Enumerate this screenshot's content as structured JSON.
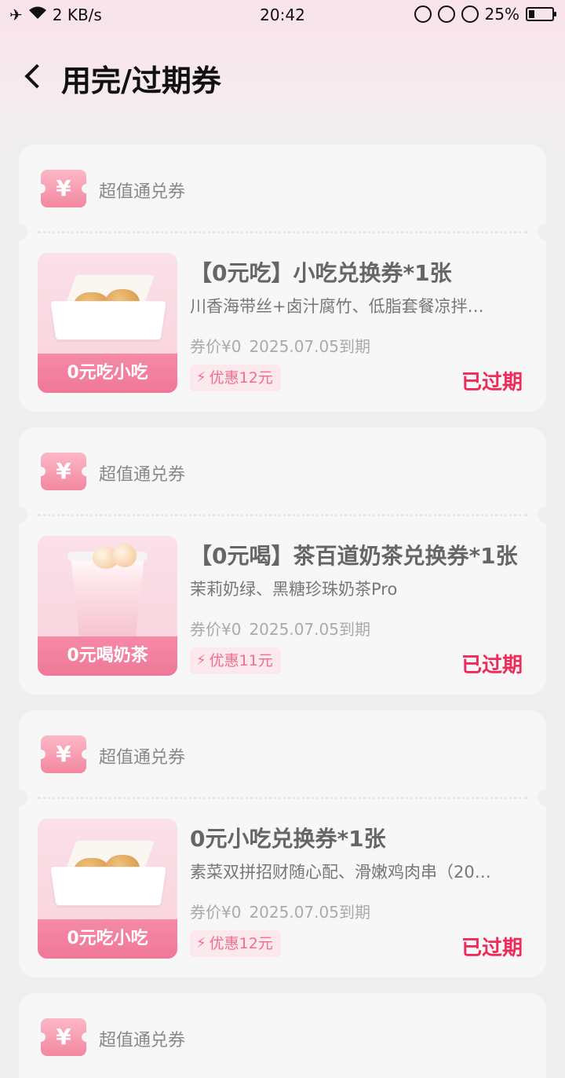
{
  "status_bar": {
    "speed": "2 KB/s",
    "time": "20:42",
    "battery_percent": "25%",
    "battery_level": 0.25
  },
  "header": {
    "title": "用完/过期券"
  },
  "cards": [
    {
      "type_label": "超值通兑券",
      "thumb_label": "0元吃小吃",
      "thumb_kind": "snack",
      "title": "【0元吃】小吃兑换券*1张",
      "desc": "川香海带丝+卤汁腐竹、低脂套餐凉拌…",
      "price": "券价¥0",
      "expiry": "2025.07.05到期",
      "discount": "优惠12元",
      "status": "已过期"
    },
    {
      "type_label": "超值通兑券",
      "thumb_label": "0元喝奶茶",
      "thumb_kind": "tea",
      "title": "【0元喝】茶百道奶茶兑换券*1张",
      "desc": "茉莉奶绿、黑糖珍珠奶茶Pro",
      "price": "券价¥0",
      "expiry": "2025.07.05到期",
      "discount": "优惠11元",
      "status": "已过期"
    },
    {
      "type_label": "超值通兑券",
      "thumb_label": "0元吃小吃",
      "thumb_kind": "snack",
      "title": "0元小吃兑换券*1张",
      "desc": "素菜双拼招财随心配、滑嫩鸡肉串（20…",
      "price": "券价¥0",
      "expiry": "2025.07.05到期",
      "discount": "优惠12元",
      "status": "已过期"
    },
    {
      "type_label": "超值通兑券"
    }
  ],
  "icons": {
    "ticket": "ticket-yen-icon",
    "discount": "lightning-icon",
    "back": "chevron-left-icon"
  },
  "colors": {
    "accent": "#ee2c5a",
    "pink": "#f06e8e",
    "thumb_band": "#f58aa6"
  }
}
